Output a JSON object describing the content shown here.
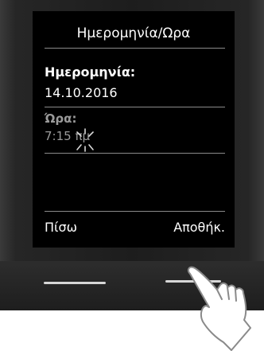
{
  "screen": {
    "title": "Ημερομηνία/Ωρα",
    "date_label": "Ημερομηνία:",
    "date_value": "14.10.2016",
    "time_label": "Ώρα:",
    "time_value": "7:15 πμ",
    "soft_left": "Πίσω",
    "soft_right": "Αποθήκ."
  },
  "icons": {
    "cursor": "blinking-cursor-icon",
    "hand": "pointing-hand-icon"
  },
  "colors": {
    "screen_bg": "#000000",
    "text": "#ffffff",
    "inactive_text": "#9a9a9a",
    "device_body": "#1d1d1d"
  }
}
